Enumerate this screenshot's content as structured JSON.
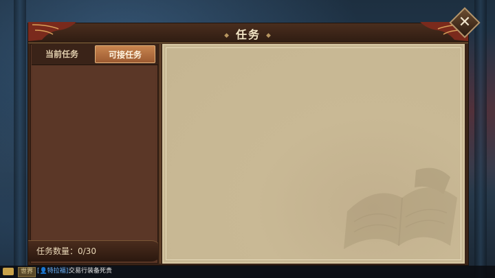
{
  "window": {
    "title": "任务"
  },
  "tabs": [
    {
      "label": "当前任务",
      "active": false
    },
    {
      "label": "可接任务",
      "active": true
    }
  ],
  "quest_count": {
    "label": "任务数量：0/30"
  },
  "chat": {
    "channel": "世界",
    "user": "[👤特拉福]:",
    "message": "交易行装备死贵"
  },
  "colors": {
    "panel_brown": "#5a3626",
    "tab_active": "#c8854f",
    "parchment": "#c9b995",
    "title_text": "#f3e6c6"
  },
  "icons": {
    "close": "close-icon",
    "watermark": "open-book-icon",
    "chat": "chat-bubble-icon"
  }
}
